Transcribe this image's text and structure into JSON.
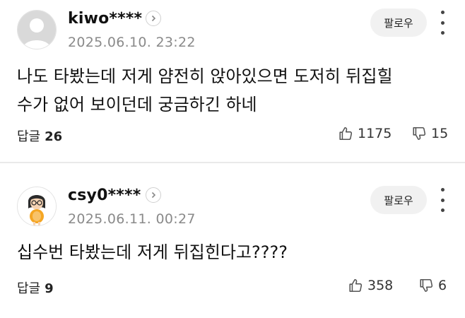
{
  "comments": [
    {
      "username": "kiwo****",
      "date": "2025.06.10. 23:22",
      "follow_label": "팔로우",
      "text_line1": "나도 타봤는데 저게 얌전히 앉아있으면 도저히 뒤집힐",
      "text_line2": "수가 없어 보이던데 궁금하긴 하네",
      "reply_label": "답글",
      "reply_count": "26",
      "likes": "1175",
      "dislikes": "15",
      "avatar": "default-avatar"
    },
    {
      "username": "csy0****",
      "date": "2025.06.11. 00:27",
      "follow_label": "팔로우",
      "text_line1": "십수번 타봤는데 저게 뒤집힌다고????",
      "reply_label": "답글",
      "reply_count": "9",
      "likes": "358",
      "dislikes": "6",
      "avatar": "character-avatar"
    }
  ],
  "icons": [
    "chevron-right-icon",
    "more-vertical-icon",
    "thumbs-up-icon",
    "thumbs-down-icon"
  ]
}
